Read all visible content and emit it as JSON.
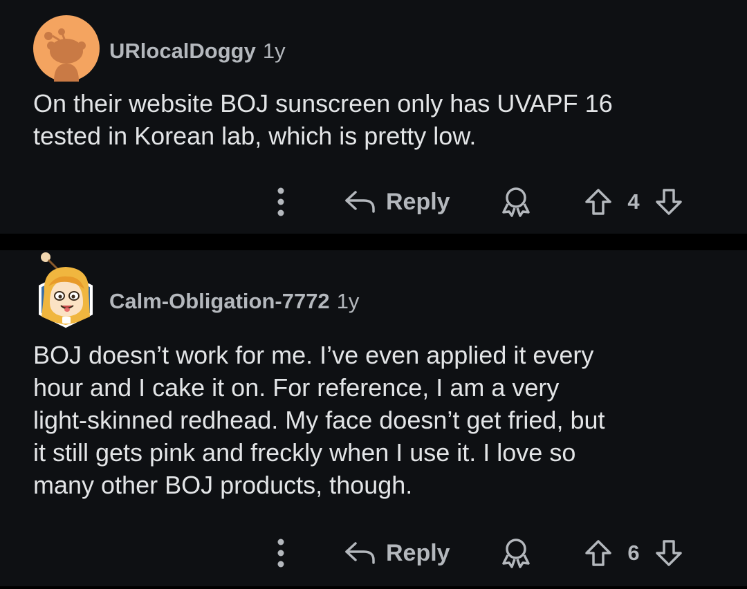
{
  "colors": {
    "background": "#0e1013",
    "separator": "#000000",
    "body_text": "#e3e5e7",
    "meta_text": "#b4b8bd",
    "avatar1_bg": "#f4a460",
    "avatar2_hair": "#f0b63f"
  },
  "comments": [
    {
      "username": "URlocalDoggy",
      "age": "1y",
      "avatar_icon": "snoo-avatar-icon",
      "body_lines": [
        "On their website BOJ sunscreen only has UVAPF 16",
        "tested in Korean lab, which is pretty low."
      ],
      "actions": {
        "more_icon": "more-vertical-icon",
        "reply_label": "Reply",
        "award_icon": "award-icon",
        "score": "4"
      }
    },
    {
      "username": "Calm-Obligation-7772",
      "age": "1y",
      "avatar_icon": "cartoon-avatar-icon",
      "body_lines": [
        "BOJ doesn’t work for me. I’ve even applied it every",
        "hour and I cake it on. For reference, I am a very",
        "light-skinned redhead. My face doesn’t get fried, but",
        "it still gets pink and freckly when I use it. I love so",
        "many other BOJ products, though."
      ],
      "actions": {
        "more_icon": "more-vertical-icon",
        "reply_label": "Reply",
        "award_icon": "award-icon",
        "score": "6"
      }
    }
  ]
}
